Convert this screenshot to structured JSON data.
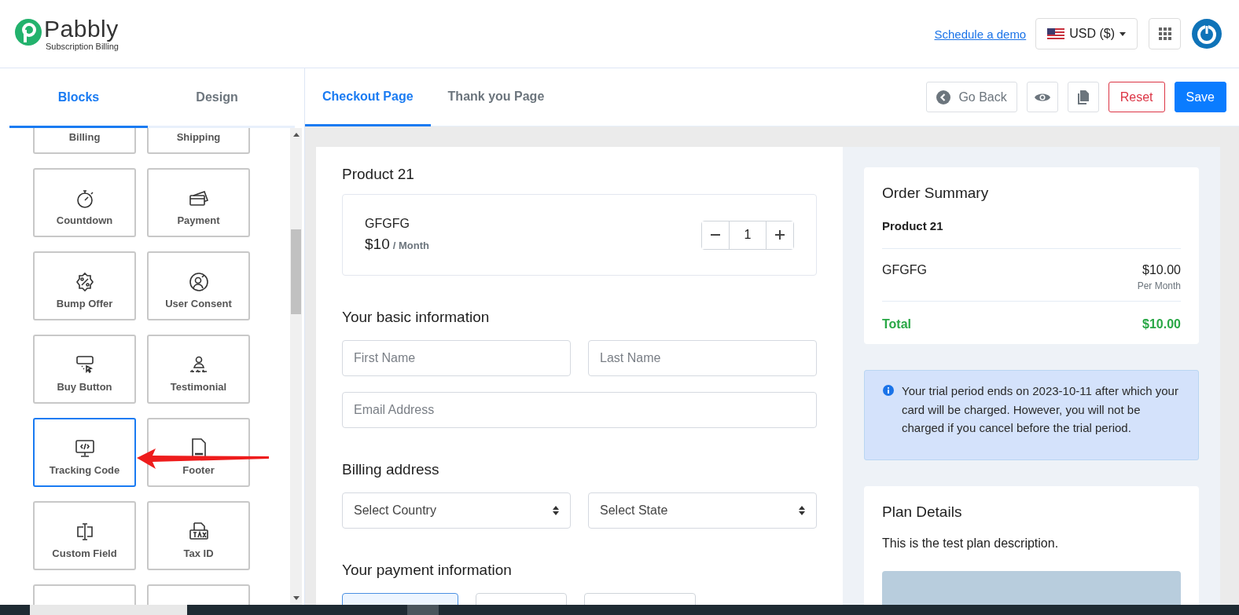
{
  "brand": {
    "name": "Pabbly",
    "tagline": "Subscription Billing"
  },
  "header": {
    "demo_link": "Schedule a demo",
    "currency": "USD ($)"
  },
  "sidebar": {
    "tabs": [
      {
        "label": "Blocks",
        "selected": true
      },
      {
        "label": "Design",
        "selected": false
      }
    ],
    "blocks": [
      {
        "label": "Billing",
        "selected": false
      },
      {
        "label": "Shipping",
        "selected": false
      },
      {
        "label": "Countdown",
        "kind": "stopwatch",
        "selected": false
      },
      {
        "label": "Payment",
        "kind": "cards",
        "selected": false
      },
      {
        "label": "Bump Offer",
        "kind": "percent",
        "selected": false
      },
      {
        "label": "User Consent",
        "kind": "usercheck",
        "selected": false
      },
      {
        "label": "Buy Button",
        "kind": "buy",
        "selected": false
      },
      {
        "label": "Testimonial",
        "kind": "rating",
        "selected": false
      },
      {
        "label": "Tracking Code",
        "kind": "code",
        "selected": true
      },
      {
        "label": "Footer",
        "kind": "document",
        "selected": false
      },
      {
        "label": "Custom Field",
        "kind": "cursor",
        "selected": false
      },
      {
        "label": "Tax ID",
        "kind": "tax",
        "selected": false
      }
    ]
  },
  "editor_tabs": [
    {
      "label": "Checkout Page",
      "selected": true
    },
    {
      "label": "Thank you Page",
      "selected": false
    }
  ],
  "toolbar": {
    "go_back": "Go Back",
    "reset": "Reset",
    "save": "Save"
  },
  "checkout": {
    "product_title": "Product 21",
    "plan": {
      "name": "GFGFG",
      "price": "$10",
      "period": "/ Month",
      "quantity": "1"
    },
    "basic_info": {
      "title": "Your basic information",
      "fields": [
        {
          "placeholder": "First Name"
        },
        {
          "placeholder": "Last Name"
        },
        {
          "placeholder": "Email Address"
        }
      ]
    },
    "billing": {
      "title": "Billing address",
      "selects": [
        "Select Country",
        "Select State"
      ]
    },
    "payment": {
      "title": "Your payment information",
      "methods": [
        {
          "selected": true
        },
        {
          "selected": false
        },
        {
          "selected": false
        }
      ]
    }
  },
  "order_summary": {
    "title": "Order Summary",
    "product": "Product 21",
    "item": {
      "name": "GFGFG",
      "price": "$10.00",
      "period": "Per Month"
    },
    "total_label": "Total",
    "total": "$10.00"
  },
  "notice": "Your trial period ends on 2023-10-11 after which your card will be charged. However, you will not be charged if you cancel before the trial period.",
  "plan_details": {
    "title": "Plan Details",
    "description": "This is the test plan description."
  }
}
